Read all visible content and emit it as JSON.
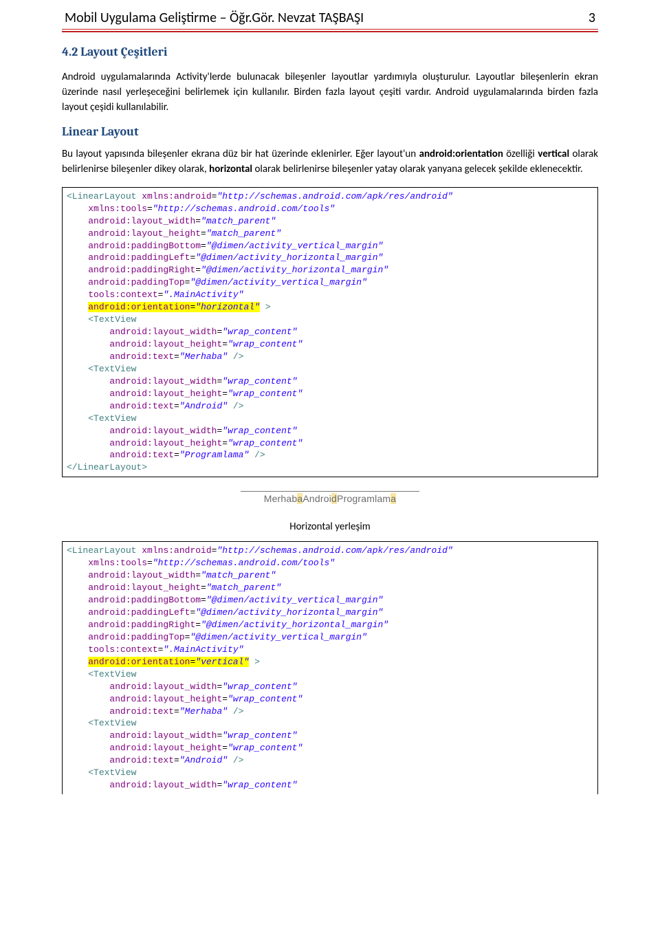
{
  "header": {
    "title": "Mobil Uygulama  Geliştirme – Öğr.Gör. Nevzat TAŞBAŞI",
    "page": "3"
  },
  "section_heading": "4.2 Layout Çeşitleri",
  "para1": "Android uygulamalarında Activity'lerde bulunacak bileşenler layoutlar yardımıyla oluşturulur. Layoutlar bileşenlerin ekran üzerinde nasıl yerleşeceğini belirlemek için kullanılır. Birden fazla layout çeşiti vardır. Android uygulamalarında birden fazla layout çeşidi kullanılabilir.",
  "subheading": "Linear Layout",
  "para2_a": "Bu layout yapısında bileşenler ekrana düz bir hat üzerinde eklenirler. Eğer layout'un ",
  "para2_b": "android:orientation",
  "para2_c": " özelliği ",
  "para2_d": "vertical",
  "para2_e": " olarak belirlenirse bileşenler dikey olarak, ",
  "para2_f": "horizontal",
  "para2_g": " olarak belirlenirse bileşenler yatay olarak yanyana gelecek şekilde eklenecektir.",
  "code1": {
    "open_tag": "<LinearLayout",
    "xmlns_android_attr": "xmlns:android",
    "xmlns_android_val": "\"http://schemas.android.com/apk/res/android\"",
    "xmlns_tools_attr": "xmlns:tools",
    "xmlns_tools_val": "\"http://schemas.android.com/tools\"",
    "lw_attr": "android:layout_width",
    "lw_val": "\"match_parent\"",
    "lh_attr": "android:layout_height",
    "lh_val": "\"match_parent\"",
    "pb_attr": "android:paddingBottom",
    "pb_val": "\"@dimen/activity_vertical_margin\"",
    "pl_attr": "android:paddingLeft",
    "pl_val": "\"@dimen/activity_horizontal_margin\"",
    "pr_attr": "android:paddingRight",
    "pr_val": "\"@dimen/activity_horizontal_margin\"",
    "pt_attr": "android:paddingTop",
    "pt_val": "\"@dimen/activity_vertical_margin\"",
    "ctx_attr": "tools:context",
    "ctx_val": "\".MainActivity\"",
    "ori_attr": "android:orientation",
    "ori_val": "\"horizontal\"",
    "close_angle": " >",
    "tv_open": "<TextView",
    "tv_lw_attr": "android:layout_width",
    "tv_lw_val": "\"wrap_content\"",
    "tv_lh_attr": "android:layout_height",
    "tv_lh_val": "\"wrap_content\"",
    "tv_txt_attr": "android:text",
    "tv_txt1": "\"Merhaba\"",
    "tv_txt2": "\"Android\"",
    "tv_txt3": "\"Programlama\"",
    "self_close": " />",
    "end_tag": "</LinearLayout>"
  },
  "emu_text": {
    "a": "Merhab",
    "b": "a",
    "c": "Androi",
    "d": "d",
    "e": "Programlam",
    "f": "a"
  },
  "caption": "Horizontal yerleşim",
  "code2": {
    "ori_val": "\"vertical\""
  }
}
